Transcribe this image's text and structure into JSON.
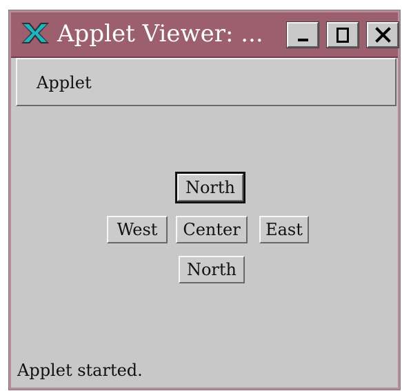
{
  "window": {
    "title": "Applet Viewer: ...",
    "controls": {
      "minimize": "minimize-icon",
      "maximize": "maximize-icon",
      "close": "close-icon"
    },
    "logo": "x-logo-icon"
  },
  "menu": {
    "label": "Applet"
  },
  "applet": {
    "buttons": {
      "north_top": "North",
      "west": "West",
      "center": "Center",
      "east": "East",
      "north_bottom": "North"
    }
  },
  "status": {
    "text": "Applet started."
  },
  "colors": {
    "title_bar": "#9b5f6e",
    "window_background": "#c8c8c8",
    "button_face": "#cbcbcb",
    "text": "#111111"
  }
}
